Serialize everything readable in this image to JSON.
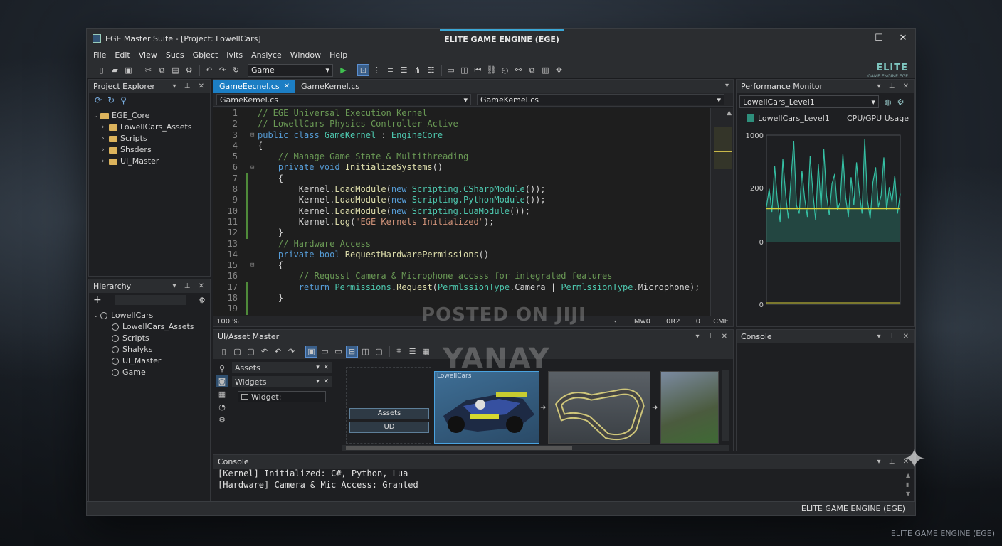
{
  "window": {
    "title": "EGE Master Suite - [Project: LowellCars]",
    "center_title": "ELITE GAME ENGINE (EGE)",
    "controls": [
      "—",
      "☐",
      "✕"
    ]
  },
  "menu": [
    "File",
    "Edit",
    "View",
    "Sucs",
    "Gbject",
    "Ivits",
    "Ansiyce",
    "Window",
    "Help"
  ],
  "toolbar": {
    "combo_value": "Game",
    "logo_text": "ELITE",
    "logo_sub": "GAME ENGINE EGE"
  },
  "project_explorer": {
    "title": "Project Explorer",
    "root": "EGE_Core",
    "items": [
      "LowellCars_Assets",
      "Scripts",
      "Shsders",
      "UI_Master"
    ]
  },
  "hierarchy": {
    "title": "Hierarchy",
    "add": "+",
    "root": "LowellCars",
    "items": [
      "LowellCars_Assets",
      "Scripts",
      "Shalyks",
      "UI_Master",
      "Game"
    ]
  },
  "editor": {
    "tabs": [
      {
        "label": "GameEecnel.cs",
        "close": "✕"
      },
      {
        "label": "GameKemel.cs"
      }
    ],
    "crumb_left": "GameKemel.cs",
    "crumb_right": "GameKemel.cs",
    "line_numbers": [
      "1",
      "2",
      "3",
      "4",
      "5",
      "6",
      "7",
      "8",
      "9",
      "10",
      "11",
      "12",
      "13",
      "14",
      "15",
      "16",
      "17",
      "18",
      "19"
    ],
    "zoom": "100 %",
    "status_items": [
      "‹",
      "Mw0",
      "0R2",
      "0",
      "CME"
    ]
  },
  "performance": {
    "title": "Performance Monitor",
    "combo_value": "LowellCars_Level1",
    "legend_label": "LowellCars_Level1",
    "chart_title": "CPU/GPU Usage"
  },
  "chart_data": {
    "type": "line",
    "title": "CPU/GPU Usage",
    "series": [
      {
        "name": "LowellCars_Level1",
        "values": [
          210,
          320,
          180,
          460,
          250,
          120,
          500,
          290,
          140,
          380,
          610,
          220,
          170,
          430,
          260,
          150,
          520,
          300,
          130,
          470,
          200,
          560,
          280,
          160,
          350,
          410,
          190,
          240,
          530,
          270,
          150,
          390,
          220,
          480,
          300,
          170,
          620,
          250,
          140,
          360,
          450,
          210,
          280,
          510,
          190,
          330,
          240,
          400,
          170,
          290
        ]
      },
      {
        "name": "",
        "values": [
          200,
          200,
          200,
          200,
          200,
          200,
          200,
          200,
          200,
          200,
          200,
          200,
          200,
          200,
          200,
          200,
          200,
          200,
          200,
          200,
          200,
          200,
          200,
          200,
          200,
          200,
          200,
          200,
          200,
          200,
          200,
          200,
          200,
          200,
          200,
          200,
          200,
          200,
          200,
          200,
          200,
          200,
          200,
          200,
          200,
          200,
          200,
          200,
          200,
          200
        ]
      }
    ],
    "y_ticks": [
      "1000",
      "200",
      "0",
      "0"
    ],
    "ylim": [
      0,
      1000
    ],
    "grid": false
  },
  "ui_asset_master": {
    "title": "UI/Asset Master",
    "assets_dropdown": "Assets",
    "widgets_dropdown": "Widgets",
    "widgets_item": "Widget:",
    "node_assets": "Assets",
    "node_ud": "UD",
    "preview_label": "LowellCars"
  },
  "console_right": {
    "title": "Console"
  },
  "console_bottom": {
    "title": "Console",
    "lines": [
      "[Kernel] Initialized: C#, Python, Lua",
      "[Hardware] Camera & Mic Access: Granted"
    ]
  },
  "status_bar": {
    "text": "ELITE GAME ENGINE (EGE)"
  },
  "watermarks": {
    "posted": "POSTED ON JIJI",
    "name": "YANAY"
  },
  "footer_text": "ELITE GAME ENGINE (EGE)"
}
